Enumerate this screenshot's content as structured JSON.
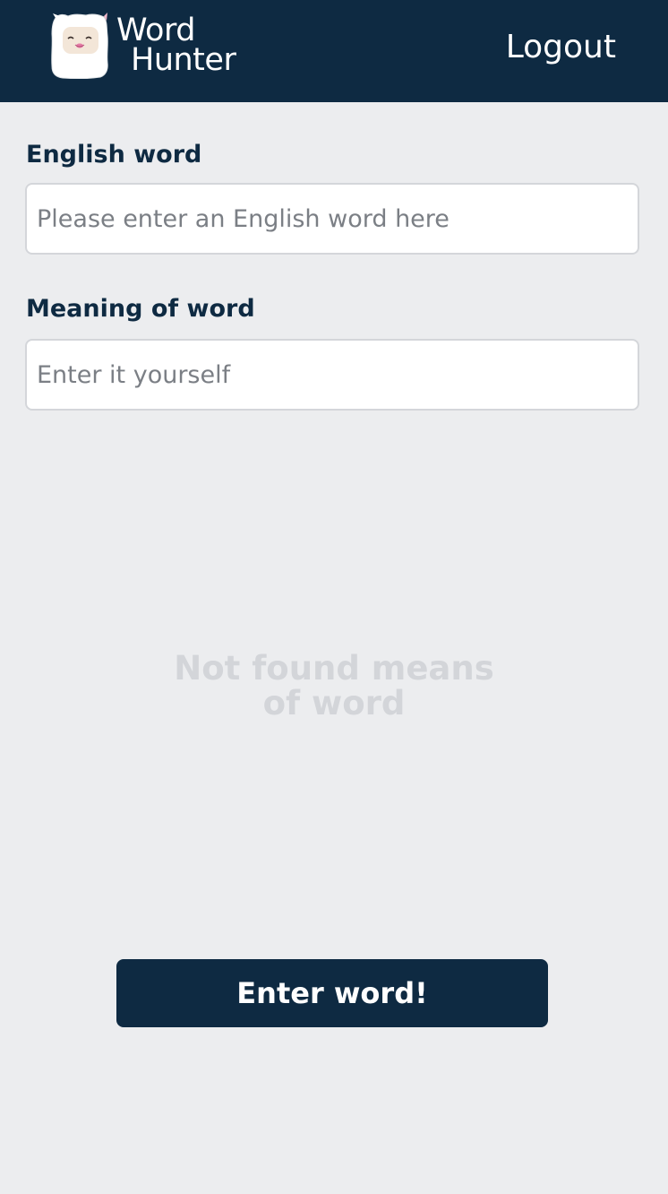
{
  "header": {
    "logo_line1": "Word",
    "logo_line2": "Hunter",
    "logo_icon": "alpaca-mascot-icon",
    "logout_label": "Logout"
  },
  "form": {
    "english_word": {
      "label": "English word",
      "value": "",
      "placeholder": "Please enter an English word here"
    },
    "meaning": {
      "label": "Meaning of word",
      "value": "",
      "placeholder": "Enter it yourself"
    }
  },
  "results": {
    "empty_line1": "Not found means",
    "empty_line2": "of word"
  },
  "actions": {
    "submit_label": "Enter word!"
  },
  "colors": {
    "primary": "#0e2a42",
    "background": "#ecedef",
    "placeholder_text": "#d3d5d9"
  }
}
